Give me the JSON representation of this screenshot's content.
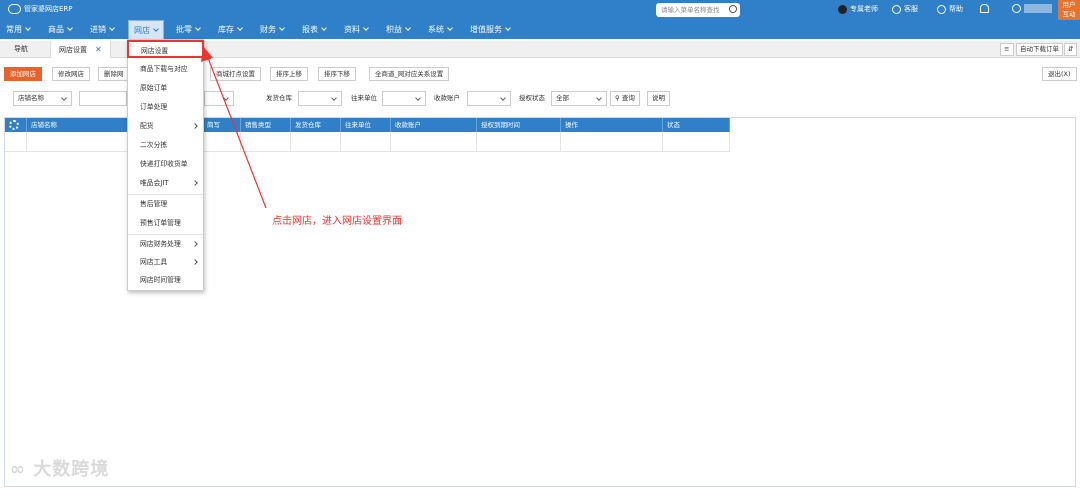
{
  "header": {
    "app_name": "管家婆网店ERP",
    "search_placeholder": "请输入菜单名称查找",
    "user_name": "专属老师",
    "service": "客服",
    "help": "帮助",
    "user_tag_line1": "用户",
    "user_tag_line2": "互动"
  },
  "nav": {
    "items": [
      "常用",
      "商品",
      "进销",
      "网店",
      "批零",
      "库存",
      "财务",
      "报表",
      "资料",
      "积益",
      "系统",
      "增值服务"
    ]
  },
  "tabs": {
    "nav_label": "导航",
    "active_label": "网店设置",
    "close": "✕",
    "auto_download": "自动下载订单"
  },
  "toolbar": {
    "add_shop": "添加网店",
    "edit_shop": "修改网店",
    "delete_shop": "删除网",
    "mall_address": "商城打点设置",
    "move_up": "排序上移",
    "move_down": "排序下移",
    "batch_settings": "全商道_网对应关系设置",
    "exit": "退出(X)"
  },
  "filters": {
    "shop_name_select": "店铺名称",
    "ship_warehouse_label": "发货仓库",
    "trade_unit_label": "往来单位",
    "receive_account_label": "收款账户",
    "auth_status_label": "授权状态",
    "auth_status_value": "全部",
    "query": "查询",
    "explain": "说明"
  },
  "table": {
    "columns": [
      "店铺名称",
      "简写",
      "销售类型",
      "发货仓库",
      "往来单位",
      "收款账户",
      "授权到期时间",
      "操作",
      "状态"
    ]
  },
  "menu": {
    "items": [
      {
        "label": "网店设置",
        "submenu": false
      },
      {
        "label": "商品下载与对应",
        "submenu": false
      },
      {
        "label": "原始订单",
        "submenu": false
      },
      {
        "label": "订单处理",
        "submenu": false
      },
      {
        "label": "配货",
        "submenu": true
      },
      {
        "label": "二次分拣",
        "submenu": false
      },
      {
        "label": "快递打印收货单",
        "submenu": false
      },
      {
        "label": "唯品会JIT",
        "submenu": true
      },
      {
        "label": "售后管理",
        "submenu": false
      },
      {
        "label": "预售订单管理",
        "submenu": false
      },
      {
        "label": "网店财务处理",
        "submenu": true
      },
      {
        "label": "网店工具",
        "submenu": true
      },
      {
        "label": "网店时间管理",
        "submenu": false
      }
    ]
  },
  "annotation": "点击网店，进入网店设置界面",
  "watermark": "大数跨境",
  "colors": {
    "brand": "#2f7fc9",
    "accent": "#e8622c",
    "highlight": "#ee3333"
  }
}
